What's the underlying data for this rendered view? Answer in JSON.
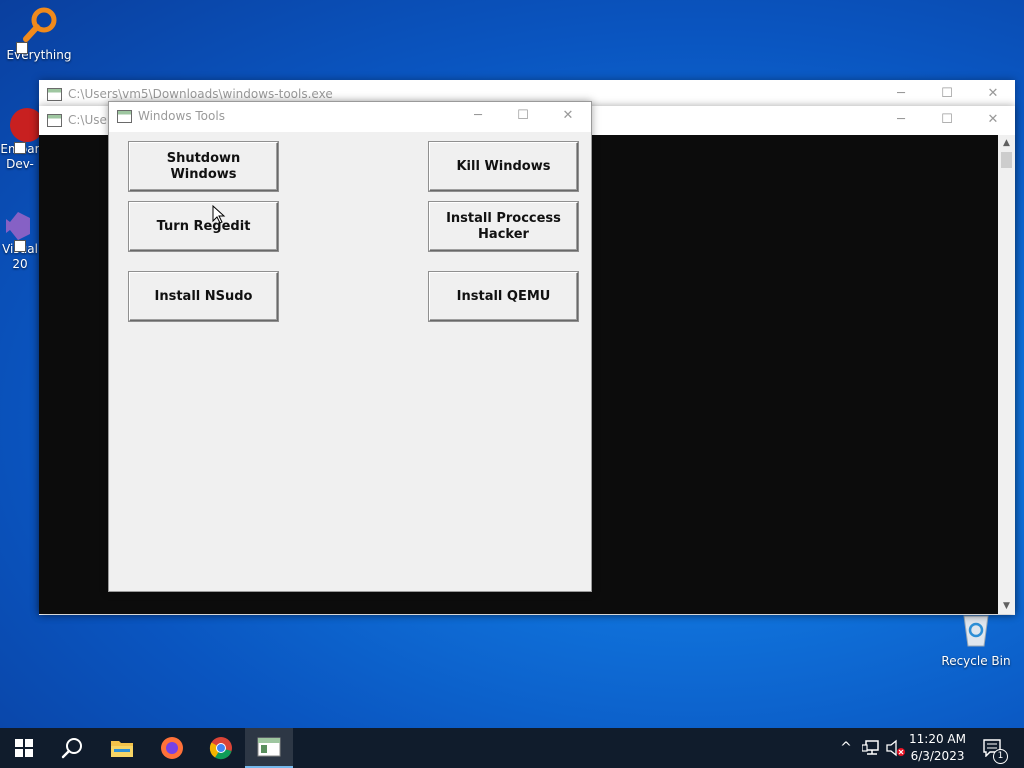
{
  "desktop": {
    "icons": [
      {
        "label": "Everything"
      },
      {
        "label": "Embar Dev-"
      },
      {
        "label": "Visual 20"
      },
      {
        "label": "Recycle Bin"
      }
    ]
  },
  "console_back": {
    "title": "C:\\Users\\vm5\\Downloads\\windows-tools.exe"
  },
  "console_front": {
    "title": "C:\\User"
  },
  "tools_window": {
    "title": "Windows Tools",
    "buttons": {
      "shutdown": "Shutdown Windows",
      "kill": "Kill Windows",
      "regedit": "Turn Regedit",
      "process_hacker": "Install Proccess Hacker",
      "nsudo": "Install NSudo",
      "qemu": "Install QEMU"
    }
  },
  "caption_buttons": {
    "minimize": "─",
    "maximize": "☐",
    "close": "✕"
  },
  "taskbar": {
    "items": [
      "start-icon",
      "search-icon",
      "file-explorer-icon",
      "firefox-icon",
      "chrome-icon",
      "windows-tools-icon"
    ],
    "tray": {
      "overflow": "^",
      "notification_count": "1"
    },
    "clock": {
      "time": "11:20 AM",
      "date": "6/3/2023"
    }
  },
  "colors": {
    "console_bg": "#0c0c0c",
    "dialog_bg": "#f0f0f0",
    "taskbar_bg": "#101c2c",
    "desktop_blue": "#0f6fd8"
  }
}
